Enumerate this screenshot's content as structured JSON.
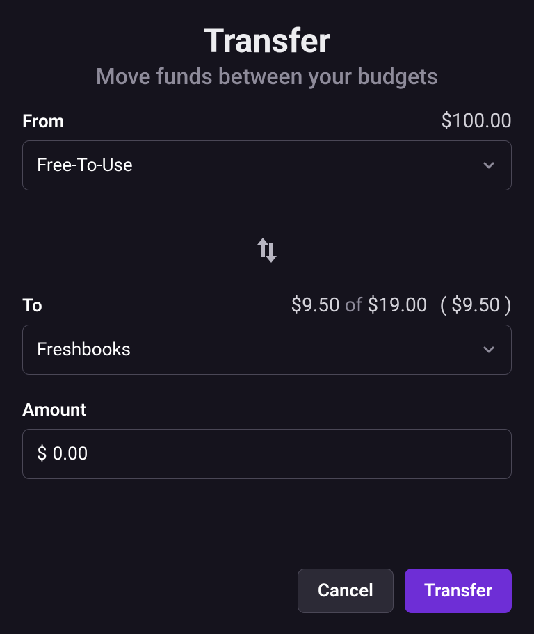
{
  "header": {
    "title": "Transfer",
    "subtitle": "Move funds between your budgets"
  },
  "from": {
    "label": "From",
    "balance": "$100.00",
    "selected": "Free-To-Use"
  },
  "to": {
    "label": "To",
    "used": "$9.50",
    "of_word": "of",
    "limit": "$19.00",
    "remaining": "( $9.50 )",
    "selected": "Freshbooks"
  },
  "amount": {
    "label": "Amount",
    "prefix": "$",
    "value": "0.00"
  },
  "actions": {
    "cancel": "Cancel",
    "transfer": "Transfer"
  }
}
